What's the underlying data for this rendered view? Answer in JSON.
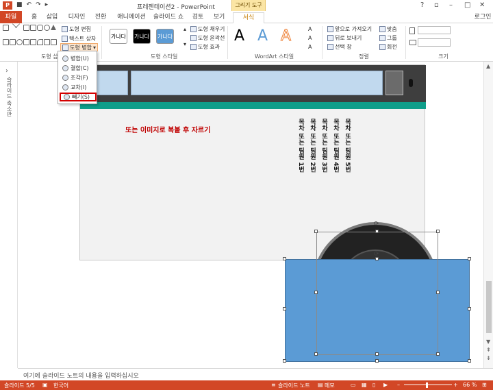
{
  "window": {
    "title": "프레젠테이션2 - PowerPoint",
    "context_tool": "그리기 도구",
    "account": "로그인",
    "app_logo": "P",
    "quick_access": [
      "save-icon",
      "undo-icon",
      "redo-icon",
      "start-icon"
    ],
    "controls": [
      "?",
      "▫",
      "–",
      "□",
      "✕"
    ]
  },
  "tabs": [
    {
      "label": "파일",
      "type": "file"
    },
    {
      "label": "홈"
    },
    {
      "label": "삽입"
    },
    {
      "label": "디자인"
    },
    {
      "label": "전환"
    },
    {
      "label": "애니메이션"
    },
    {
      "label": "슬라이드 쇼"
    },
    {
      "label": "검토"
    },
    {
      "label": "보기"
    },
    {
      "label": "서식",
      "active": true,
      "context": true
    }
  ],
  "ribbon": {
    "insert_shapes": {
      "label": "도형 삽입",
      "edit_shape": "도형 편집",
      "text_box": "텍스트 상자",
      "merge_shapes": "도형 병합"
    },
    "shape_styles": {
      "label": "도형 스타일",
      "swatches": [
        "가나다",
        "가나다",
        "가나다"
      ],
      "fill": "도형 채우기",
      "outline": "도형 윤곽선",
      "effects": "도형 효과"
    },
    "wordart": {
      "label": "WordArt 스타일",
      "letters": [
        "A",
        "A",
        "A"
      ]
    },
    "arrange": {
      "label": "정렬",
      "bring_forward": "앞으로 가져오기",
      "send_backward": "뒤로 보내기",
      "selection_pane": "선택 창",
      "align": "맞춤",
      "group": "그룹",
      "rotate": "회전"
    },
    "size": {
      "label": "크기"
    }
  },
  "merge_menu": {
    "items": [
      {
        "label": "병합(U)"
      },
      {
        "label": "결합(C)"
      },
      {
        "label": "조각(F)"
      },
      {
        "label": "교차(I)"
      },
      {
        "label": "빼기(S)",
        "highlighted": true
      }
    ]
  },
  "left_panel": {
    "vertical_label": "슬라이드 축소판"
  },
  "slide": {
    "red_text": "또는 이미지로 복붙 후 자르기",
    "vertical_columns": [
      "목차 또는 팀원 1번",
      "목차 또는 팀원 2번",
      "목차 또는 팀원 3번",
      "목차 또는 팀원 4번",
      "목차 또는 팀원 5번"
    ],
    "colors": {
      "teal_bar": "#0f9e8a",
      "blue_shape": "#5b9bd5",
      "red_text": "#c00000",
      "light_panel": "#c1d9ee"
    }
  },
  "notes": {
    "placeholder": "여기에 슬라이드 노트의 내용을 입력하십시오"
  },
  "status": {
    "slide": "슬라이드 5/5",
    "language": "한국어",
    "notes_btn": "슬라이드 노트",
    "memo_btn": "메모",
    "zoom": "66 %"
  }
}
